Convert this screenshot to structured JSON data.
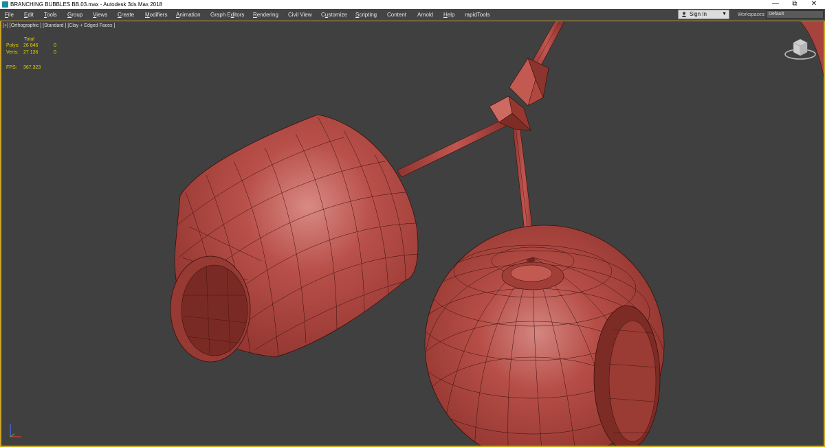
{
  "window": {
    "title": "BRANCHING BUBBLES BB.03.max - Autodesk 3ds Max 2018",
    "controls": [
      "minimize-icon",
      "restore-icon",
      "close-icon"
    ]
  },
  "menubar": {
    "items": [
      {
        "pre": "",
        "u": "F",
        "post": "ile"
      },
      {
        "pre": "",
        "u": "E",
        "post": "dit"
      },
      {
        "pre": "",
        "u": "T",
        "post": "ools"
      },
      {
        "pre": "",
        "u": "G",
        "post": "roup"
      },
      {
        "pre": "",
        "u": "V",
        "post": "iews"
      },
      {
        "pre": "",
        "u": "C",
        "post": "reate"
      },
      {
        "pre": "",
        "u": "M",
        "post": "odifiers"
      },
      {
        "pre": "",
        "u": "A",
        "post": "nimation"
      },
      {
        "pre": "Graph E",
        "u": "d",
        "post": "itors"
      },
      {
        "pre": "",
        "u": "R",
        "post": "endering"
      },
      {
        "pre": "Civil View",
        "u": "",
        "post": ""
      },
      {
        "pre": "C",
        "u": "u",
        "post": "stomize"
      },
      {
        "pre": "",
        "u": "S",
        "post": "cripting"
      },
      {
        "pre": "Content",
        "u": "",
        "post": ""
      },
      {
        "pre": "Arnold",
        "u": "",
        "post": ""
      },
      {
        "pre": "",
        "u": "H",
        "post": "elp"
      },
      {
        "pre": "rapidTools",
        "u": "",
        "post": ""
      }
    ],
    "signin": "Sign In",
    "workspaces_label": "Workspaces:",
    "workspaces_value": "Default"
  },
  "viewport": {
    "label": "[+] [Orthographic ] [Standard ] [Clay + Edged Faces ]",
    "stats": {
      "header": "Total",
      "polys_label": "Polys:",
      "polys_value": "26 846",
      "polys_sel": "0",
      "verts_label": "Verts:",
      "verts_value": "27 136",
      "verts_sel": "0",
      "fps_label": "FPS:",
      "fps_value": "367,323"
    },
    "colors": {
      "background": "#404040",
      "clay": "#b0453e",
      "wire": "#3a0f0c",
      "active_border": "#c9a52a",
      "stats_text": "#e4d200"
    }
  }
}
